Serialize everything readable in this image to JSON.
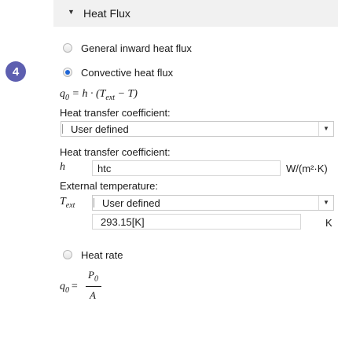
{
  "section": {
    "title": "Heat Flux"
  },
  "step_badge": "4",
  "radios": {
    "general": "General inward heat flux",
    "convective": "Convective heat flux",
    "heat_rate": "Heat rate"
  },
  "equations": {
    "convective": {
      "q0": "q",
      "q0_sub": "0",
      "rest": " = h · (T",
      "ext_sub": "ext",
      "tail": " − T)"
    },
    "rate": {
      "q0": "q",
      "q0_sub": "0",
      "eq": " = ",
      "num": "P",
      "num_sub": "0",
      "den": "A"
    }
  },
  "htc_select": {
    "label": "Heat transfer coefficient:",
    "value": "User defined"
  },
  "htc_field": {
    "label": "Heat transfer coefficient:",
    "symbol": "h",
    "value": "htc",
    "unit": "W/(m²·K)"
  },
  "ext_temp": {
    "label": "External temperature:",
    "symbol": "T",
    "symbol_sub": "ext",
    "select_value": "User defined",
    "value": "293.15[K]",
    "unit": "K"
  }
}
